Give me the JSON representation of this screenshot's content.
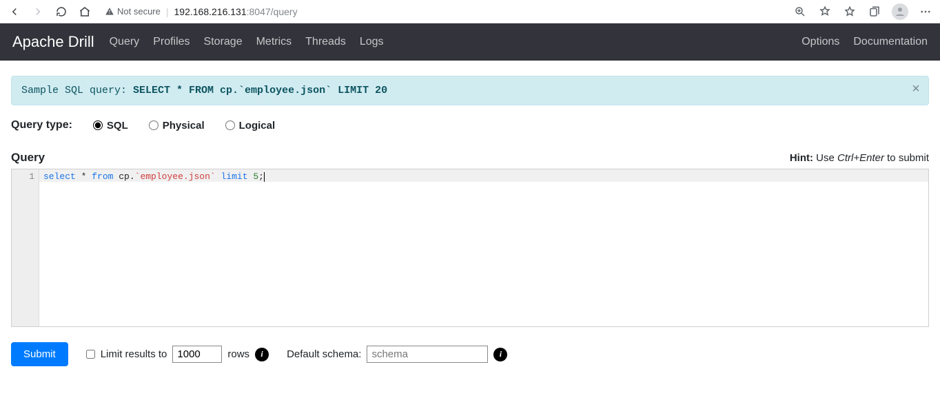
{
  "browser": {
    "not_secure": "Not secure",
    "url_host": "192.168.216.131",
    "url_port_path": ":8047/query"
  },
  "navbar": {
    "brand": "Apache Drill",
    "links": [
      "Query",
      "Profiles",
      "Storage",
      "Metrics",
      "Threads",
      "Logs"
    ],
    "right": [
      "Options",
      "Documentation"
    ]
  },
  "alert": {
    "prefix": "Sample SQL query: ",
    "query": "SELECT * FROM cp.`employee.json` LIMIT 20"
  },
  "query_type": {
    "label": "Query type:",
    "options": [
      "SQL",
      "Physical",
      "Logical"
    ],
    "selected": "SQL"
  },
  "editor": {
    "title": "Query",
    "hint_label": "Hint:",
    "hint_text_pre": " Use ",
    "hint_shortcut": "Ctrl+Enter",
    "hint_text_post": " to submit",
    "line_number": "1",
    "code": {
      "kw_select": "select",
      "star": " * ",
      "kw_from": "from",
      "tbl_pre": " cp.",
      "tbl_str": "`employee.json`",
      "sp": " ",
      "kw_limit": "limit",
      "sp2": " ",
      "num": "5",
      "semi": ";"
    }
  },
  "controls": {
    "submit": "Submit",
    "limit_label": "Limit results to",
    "limit_value": "1000",
    "limit_suffix": "rows",
    "schema_label": "Default schema:",
    "schema_placeholder": "schema"
  }
}
